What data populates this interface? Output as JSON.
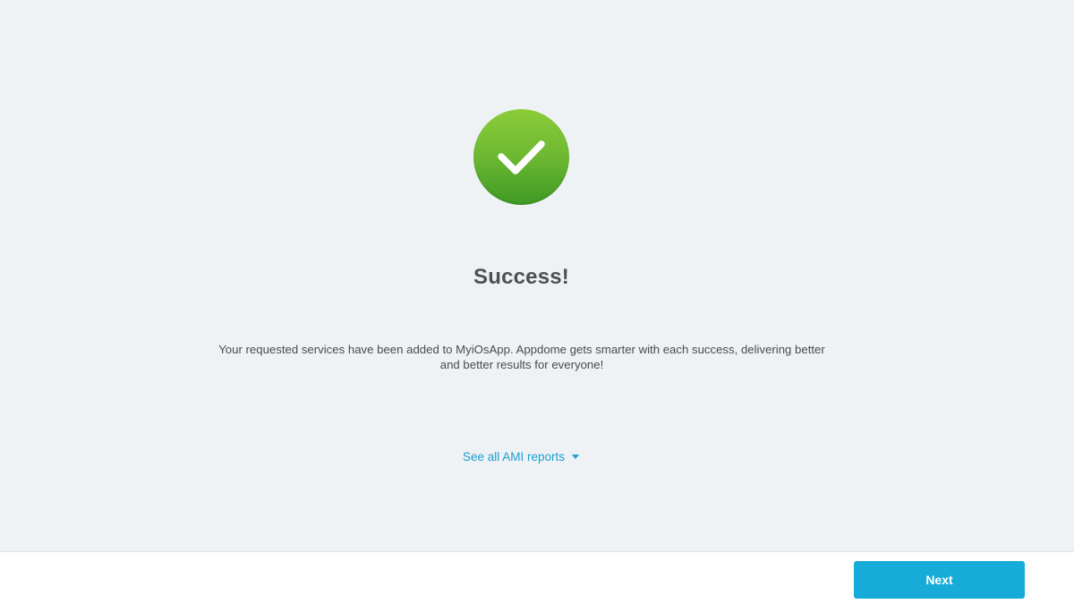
{
  "status": {
    "icon": "check-circle-icon",
    "icon_color": "#6db832",
    "title": "Success!",
    "message": "Your requested services have been added to MyiOsApp. Appdome gets smarter with each success, delivering better and better results for everyone!"
  },
  "reports": {
    "link_label": "See all AMI reports",
    "icon": "caret-down-icon",
    "link_color": "#1a9fd1"
  },
  "footer": {
    "next_label": "Next",
    "button_color": "#17acd8"
  }
}
